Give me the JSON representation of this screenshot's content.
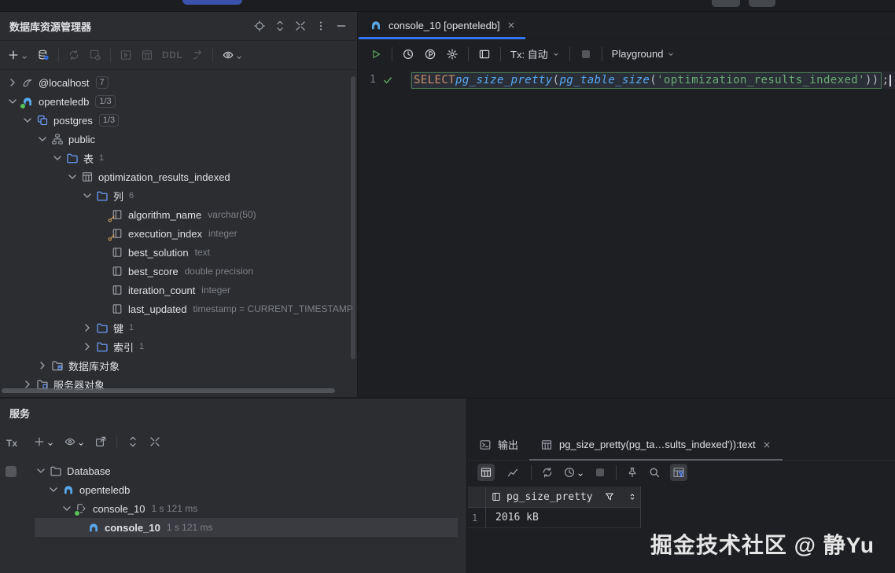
{
  "explorer": {
    "title": "数据库资源管理器",
    "toolbar": {
      "ddl": "DDL"
    },
    "rows": [
      {
        "label": "@localhost",
        "badge": "7"
      },
      {
        "label": "openteledb",
        "badge": "1/3"
      },
      {
        "label": "postgres",
        "badge": "1/3"
      },
      {
        "label": "public"
      },
      {
        "label": "表",
        "count": "1"
      },
      {
        "label": "optimization_results_indexed"
      },
      {
        "label": "列",
        "count": "6"
      },
      {
        "label": "algorithm_name",
        "type": "varchar(50)"
      },
      {
        "label": "execution_index",
        "type": "integer"
      },
      {
        "label": "best_solution",
        "type": "text"
      },
      {
        "label": "best_score",
        "type": "double precision"
      },
      {
        "label": "iteration_count",
        "type": "integer"
      },
      {
        "label": "last_updated",
        "type": "timestamp = CURRENT_TIMESTAMP"
      },
      {
        "label": "键",
        "count": "1"
      },
      {
        "label": "索引",
        "count": "1"
      },
      {
        "label": "数据库对象"
      },
      {
        "label": "服务器对象"
      }
    ]
  },
  "editor": {
    "tab_title": "console_10 [openteledb]",
    "toolbar": {
      "tx": "Tx: 自动",
      "profile": "Playground"
    },
    "line_number": "1",
    "code": {
      "kw": "SELECT ",
      "fn1": "pg_size_pretty",
      "p1": "(",
      "fn2": "pg_table_size",
      "p2": "(",
      "str": "'optimization_results_indexed'",
      "p3": "))",
      "semi": ";"
    }
  },
  "services": {
    "title": "服务",
    "tx": "Tx",
    "rows": [
      {
        "label": "Database"
      },
      {
        "label": "openteledb"
      },
      {
        "label": "console_10",
        "meta": "1 s 121 ms"
      },
      {
        "label": "console_10",
        "meta": "1 s 121 ms"
      }
    ]
  },
  "output": {
    "tab_output": "输出",
    "tab_result": "pg_size_pretty(pg_ta…sults_indexed')):text",
    "grid": {
      "column": "pg_size_pretty",
      "row_number": "1",
      "value": "2016 kB"
    }
  },
  "watermark": "掘金技术社区 @ 静Yu",
  "colors": {
    "accent": "#3574F0",
    "run_green": "#57965C",
    "statement_border": "#4A7A52",
    "postgres_blue": "#59A7E8",
    "key_gold": "#D6A35C"
  }
}
